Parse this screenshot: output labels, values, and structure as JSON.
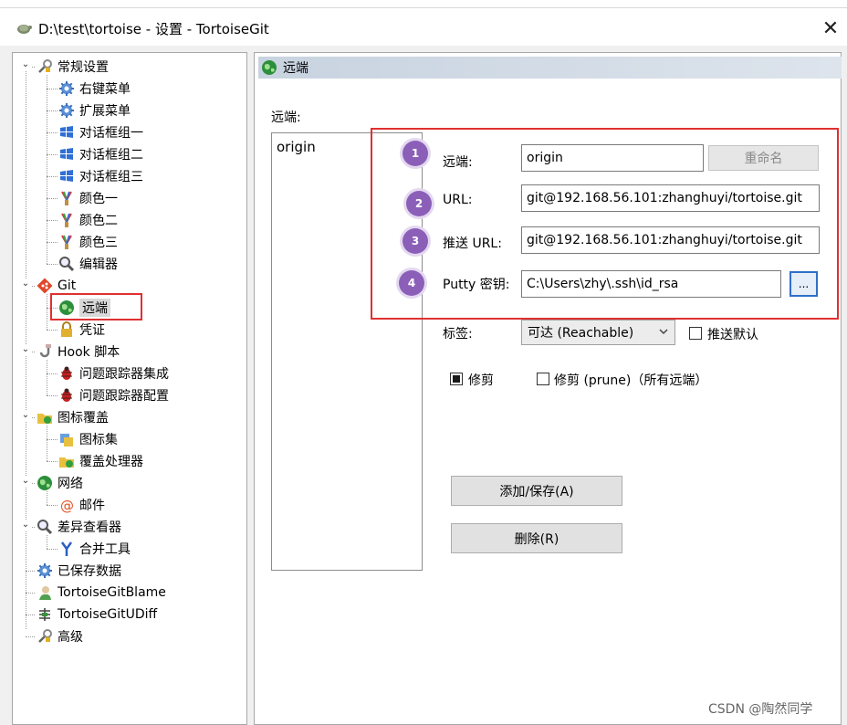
{
  "window": {
    "title": "D:\\test\\tortoise - 设置 - TortoiseGit",
    "close_glyph": "✕"
  },
  "tree": {
    "items": [
      {
        "label": "常规设置",
        "icon": "wrench-icon"
      },
      {
        "label": "右键菜单",
        "icon": "gear-icon"
      },
      {
        "label": "扩展菜单",
        "icon": "gear-icon"
      },
      {
        "label": "对话框组一",
        "icon": "windows-icon"
      },
      {
        "label": "对话框组二",
        "icon": "windows-icon"
      },
      {
        "label": "对话框组三",
        "icon": "windows-icon"
      },
      {
        "label": "颜色一",
        "icon": "brush-icon"
      },
      {
        "label": "颜色二",
        "icon": "brush-icon"
      },
      {
        "label": "颜色三",
        "icon": "brush-icon"
      },
      {
        "label": "编辑器",
        "icon": "magnifier-icon"
      },
      {
        "label": "Git",
        "icon": "git-icon"
      },
      {
        "label": "远端",
        "icon": "globe-icon"
      },
      {
        "label": "凭证",
        "icon": "lock-icon"
      },
      {
        "label": "Hook 脚本",
        "icon": "hook-icon"
      },
      {
        "label": "问题跟踪器集成",
        "icon": "bug-icon"
      },
      {
        "label": "问题跟踪器配置",
        "icon": "bug-icon"
      },
      {
        "label": "图标覆盖",
        "icon": "folder-overlay-icon"
      },
      {
        "label": "图标集",
        "icon": "iconset-icon"
      },
      {
        "label": "覆盖处理器",
        "icon": "folder-overlay-icon"
      },
      {
        "label": "网络",
        "icon": "globe-icon"
      },
      {
        "label": "邮件",
        "icon": "at-icon"
      },
      {
        "label": "差异查看器",
        "icon": "magnifier-icon"
      },
      {
        "label": "合并工具",
        "icon": "merge-icon"
      },
      {
        "label": "已保存数据",
        "icon": "gear-icon"
      },
      {
        "label": "TortoiseGitBlame",
        "icon": "blame-icon"
      },
      {
        "label": "TortoiseGitUDiff",
        "icon": "udiff-icon"
      },
      {
        "label": "高级",
        "icon": "wrench-icon"
      }
    ],
    "expander_glyph": "⌄"
  },
  "page": {
    "header_title": "远端",
    "remote_list_label": "远端:",
    "remotes": [
      "origin"
    ],
    "form": {
      "remote_label": "远端:",
      "remote_value": "origin",
      "rename_button": "重命名",
      "url_label": "URL:",
      "url_value": "git@192.168.56.101:zhanghuyi/tortoise.git",
      "push_url_label": "推送 URL:",
      "push_url_value": "git@192.168.56.101:zhanghuyi/tortoise.git",
      "putty_label": "Putty 密钥:",
      "putty_value": "C:\\Users\\zhy\\.ssh\\id_rsa",
      "browse_button": "...",
      "tags_label": "标签:",
      "tags_selected": "可达 (Reachable)",
      "push_default_label": "推送默认",
      "prune_label": "修剪",
      "prune_all_label": "修剪 (prune)（所有远端）",
      "add_save_button": "添加/保存(A)",
      "delete_button": "删除(R)"
    },
    "badges": [
      "1",
      "2",
      "3",
      "4"
    ]
  },
  "watermark": "CSDN @陶然同学",
  "colors": {
    "highlight_red": "#e03030",
    "badge_purple": "#8b5fb8",
    "header_bar": "#c8d3e0"
  }
}
